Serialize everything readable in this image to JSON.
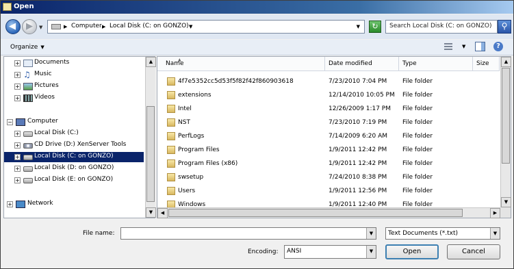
{
  "window": {
    "title": "Open"
  },
  "address": {
    "crumbs": [
      "Computer",
      "Local Disk (C: on GONZO)"
    ],
    "search_placeholder": "Search Local Disk (C: on GONZO)"
  },
  "toolbar": {
    "organize": "Organize"
  },
  "nav": {
    "items": [
      {
        "label": "Documents",
        "icon": "documents-icon"
      },
      {
        "label": "Music",
        "icon": "music-icon"
      },
      {
        "label": "Pictures",
        "icon": "pictures-icon"
      },
      {
        "label": "Videos",
        "icon": "videos-icon"
      },
      {
        "label": "Computer",
        "icon": "computer-icon"
      },
      {
        "label": "Local Disk (C:)",
        "icon": "disk-icon"
      },
      {
        "label": "CD Drive (D:) XenServer Tools",
        "icon": "cd-icon"
      },
      {
        "label": "Local Disk (C: on GONZO)",
        "icon": "disk-icon",
        "selected": true
      },
      {
        "label": "Local Disk (D: on GONZO)",
        "icon": "disk-icon"
      },
      {
        "label": "Local Disk (E: on GONZO)",
        "icon": "disk-icon"
      },
      {
        "label": "Network",
        "icon": "network-icon"
      }
    ]
  },
  "files": {
    "columns": [
      "Name",
      "Date modified",
      "Type",
      "Size"
    ],
    "rows": [
      {
        "name": "4f7e5352cc5d53f5f82f42f860903618",
        "date": "7/23/2010 7:04 PM",
        "type": "File folder"
      },
      {
        "name": "extensions",
        "date": "12/14/2010 10:05 PM",
        "type": "File folder"
      },
      {
        "name": "Intel",
        "date": "12/26/2009 1:17 PM",
        "type": "File folder"
      },
      {
        "name": "NST",
        "date": "7/23/2010 7:19 PM",
        "type": "File folder"
      },
      {
        "name": "PerfLogs",
        "date": "7/14/2009 6:20 AM",
        "type": "File folder"
      },
      {
        "name": "Program Files",
        "date": "1/9/2011 12:42 PM",
        "type": "File folder"
      },
      {
        "name": "Program Files (x86)",
        "date": "1/9/2011 12:42 PM",
        "type": "File folder"
      },
      {
        "name": "swsetup",
        "date": "7/24/2010 8:38 PM",
        "type": "File folder"
      },
      {
        "name": "Users",
        "date": "1/9/2011 12:56 PM",
        "type": "File folder"
      },
      {
        "name": "Windows",
        "date": "1/9/2011 12:40 PM",
        "type": "File folder"
      }
    ]
  },
  "bottom": {
    "filename_label": "File name:",
    "filename_value": "",
    "filetype": "Text Documents (*.txt)",
    "encoding_label": "Encoding:",
    "encoding_value": "ANSI",
    "open_label": "Open",
    "cancel_label": "Cancel"
  }
}
